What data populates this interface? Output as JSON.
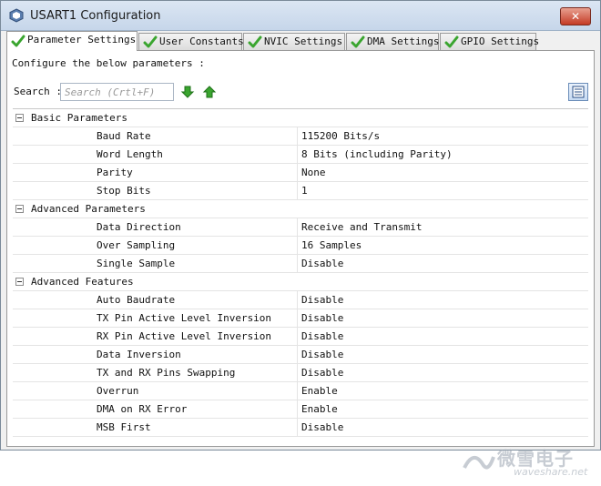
{
  "window": {
    "title": "USART1 Configuration",
    "close_label": "✕"
  },
  "tabs": [
    {
      "label": "Parameter Settings",
      "active": true
    },
    {
      "label": "User Constants",
      "active": false
    },
    {
      "label": "NVIC Settings",
      "active": false
    },
    {
      "label": "DMA Settings",
      "active": false
    },
    {
      "label": "GPIO Settings",
      "active": false
    }
  ],
  "panel": {
    "configure_text": "Configure the below parameters :",
    "search_label": "Search :",
    "search_placeholder": "Search (Crtl+F)"
  },
  "groups": [
    {
      "name": "Basic Parameters",
      "params": [
        {
          "name": "Baud Rate",
          "value": "115200 Bits/s"
        },
        {
          "name": "Word Length",
          "value": "8 Bits (including Parity)"
        },
        {
          "name": "Parity",
          "value": "None"
        },
        {
          "name": "Stop Bits",
          "value": "1"
        }
      ]
    },
    {
      "name": "Advanced Parameters",
      "params": [
        {
          "name": "Data Direction",
          "value": "Receive and Transmit"
        },
        {
          "name": "Over Sampling",
          "value": "16 Samples"
        },
        {
          "name": "Single Sample",
          "value": "Disable"
        }
      ]
    },
    {
      "name": "Advanced Features",
      "params": [
        {
          "name": "Auto Baudrate",
          "value": "Disable"
        },
        {
          "name": "TX Pin Active Level Inversion",
          "value": "Disable"
        },
        {
          "name": "RX Pin Active Level Inversion",
          "value": "Disable"
        },
        {
          "name": "Data Inversion",
          "value": "Disable"
        },
        {
          "name": "TX and RX Pins Swapping",
          "value": "Disable"
        },
        {
          "name": "Overrun",
          "value": "Enable"
        },
        {
          "name": "DMA on RX Error",
          "value": "Enable"
        },
        {
          "name": "MSB First",
          "value": "Disable"
        }
      ]
    }
  ],
  "watermark": {
    "big": "微雪电子",
    "small": "waveshare.net"
  },
  "colors": {
    "check_green": "#3aa52f",
    "arrow_green": "#2f9a25",
    "title_bar": "#c6d6ea"
  }
}
